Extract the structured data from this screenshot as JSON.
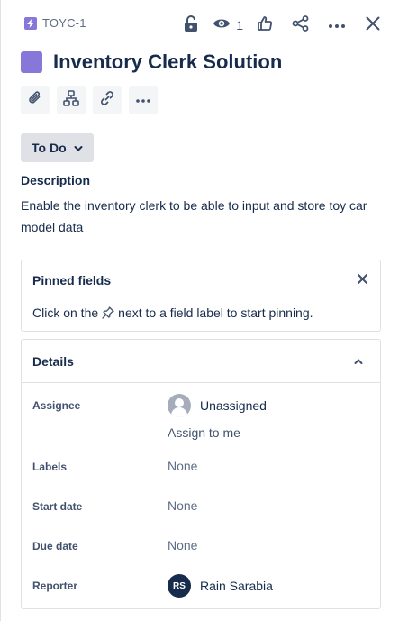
{
  "header": {
    "issue_key": "TOYC-1",
    "watch_count": "1",
    "icons": {
      "issue_type": "lightning-icon",
      "restrict": "lock-open-icon",
      "watch": "eye-icon",
      "vote": "thumbs-up-icon",
      "share": "share-icon",
      "more": "more-icon",
      "close": "close-icon"
    }
  },
  "issue": {
    "title": "Inventory Clerk Solution",
    "type_color": "#8777d9"
  },
  "quick_actions": [
    "attach-icon",
    "child-issue-icon",
    "link-icon",
    "more-icon"
  ],
  "status": {
    "label": "To Do"
  },
  "description": {
    "heading": "Description",
    "body": "Enable the inventory clerk to be able to input and store toy car model data"
  },
  "pinned_fields": {
    "title": "Pinned fields",
    "hint_before": "Click on the",
    "hint_after": "next to a field label to start pinning."
  },
  "details": {
    "title": "Details",
    "assignee": {
      "label": "Assignee",
      "value": "Unassigned",
      "action": "Assign to me"
    },
    "labels": {
      "label": "Labels",
      "value": "None"
    },
    "start_date": {
      "label": "Start date",
      "value": "None"
    },
    "due_date": {
      "label": "Due date",
      "value": "None"
    },
    "reporter": {
      "label": "Reporter",
      "initials": "RS",
      "value": "Rain Sarabia"
    }
  },
  "colors": {
    "text": "#172b4d",
    "subtle": "#5e6c84",
    "accent": "#8777d9",
    "status_bg": "#dfe1e6",
    "border": "#dfe1e6"
  }
}
